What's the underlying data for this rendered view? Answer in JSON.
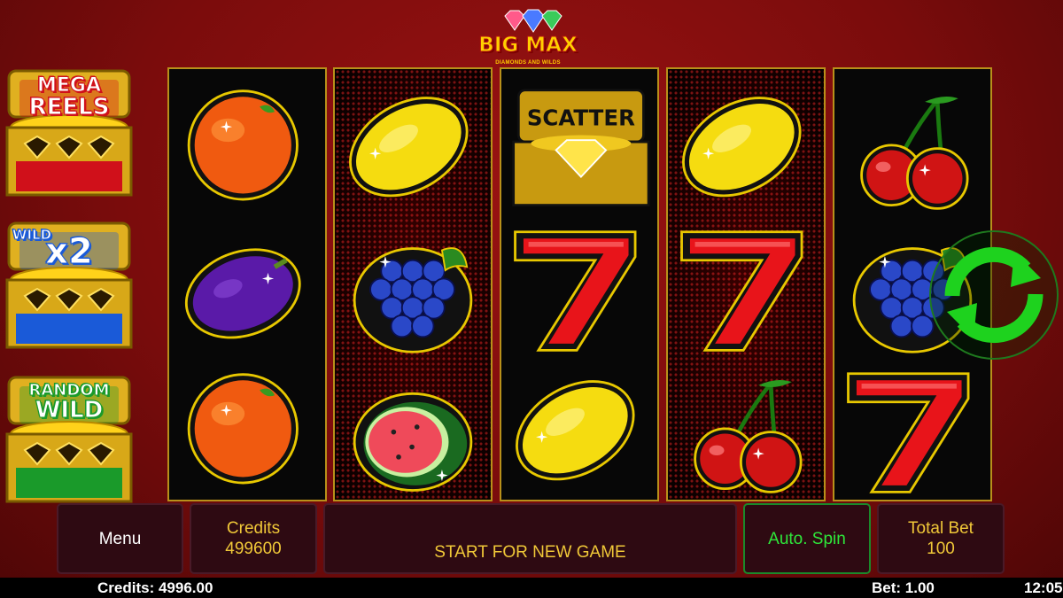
{
  "logo": {
    "title": "BIG MAX",
    "subtitle": "DIAMONDS AND WILDS"
  },
  "features": [
    {
      "line1": "MEGA",
      "line2": "REELS",
      "color": "#d0101a"
    },
    {
      "line1": "WILD",
      "line2": "x2",
      "color": "#1a5ad8"
    },
    {
      "line1": "RANDOM",
      "line2": "WILD",
      "color": "#1a9a2a"
    }
  ],
  "reels": [
    [
      "orange",
      "plum",
      "orange"
    ],
    [
      "lemon",
      "grapes",
      "watermelon"
    ],
    [
      "scatter",
      "seven",
      "lemon"
    ],
    [
      "lemon",
      "seven",
      "cherries"
    ],
    [
      "cherries",
      "grapes",
      "seven"
    ]
  ],
  "scatter_label": "SCATTER",
  "panel": {
    "menu": "Menu",
    "credits_label": "Credits",
    "credits_value": "499600",
    "message": "START FOR NEW GAME",
    "autospin": "Auto. Spin",
    "total_bet_label": "Total Bet",
    "total_bet_value": "100"
  },
  "status": {
    "credits": "Credits: 4996.00",
    "bet": "Bet: 1.00",
    "time": "12:05"
  },
  "colors": {
    "accent_gold": "#f0c838",
    "autospin_green": "#2ee63a",
    "spin_icon": "#22dd22"
  }
}
